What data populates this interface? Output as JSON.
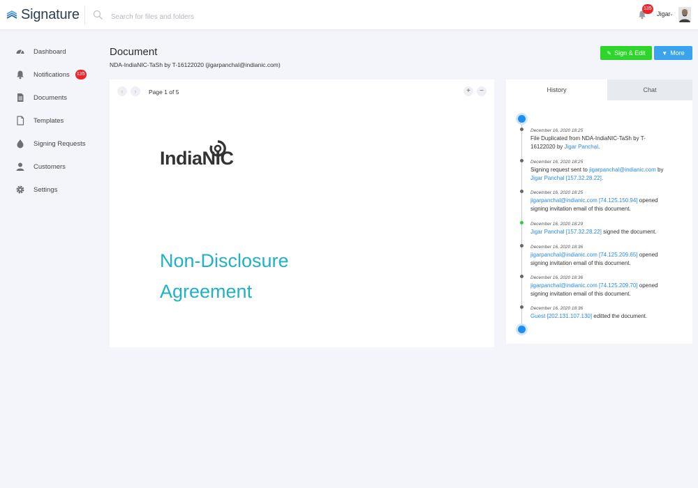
{
  "app": {
    "name": "Signature"
  },
  "search": {
    "placeholder": "Search for files and folders"
  },
  "topbar": {
    "notification_count": "135",
    "user_name": "Jigar",
    "chevron": "⌄"
  },
  "sidebar": {
    "items": [
      {
        "label": "Dashboard",
        "icon": "dashboard-icon"
      },
      {
        "label": "Notifications",
        "icon": "bell-icon",
        "badge": "135"
      },
      {
        "label": "Documents",
        "icon": "document-icon"
      },
      {
        "label": "Templates",
        "icon": "template-icon"
      },
      {
        "label": "Signing Requests",
        "icon": "signing-request-icon"
      },
      {
        "label": "Customers",
        "icon": "customers-icon"
      },
      {
        "label": "Settings",
        "icon": "gear-icon"
      }
    ]
  },
  "header": {
    "title": "Document",
    "subtitle": "NDA-IndiaNIC-TaSh by T-16122020 (jigarpanchal@indianic.com)",
    "sign_edit_label": "Sign & Edit",
    "more_label": "More"
  },
  "viewer": {
    "prev": "‹",
    "next": "›",
    "page_text": "Page 1 of 5",
    "zoom_in": "+",
    "zoom_out": "−",
    "logo_text": "IndiaNIC",
    "doc_title_line1": "Non-Disclosure",
    "doc_title_line2": "Agreement"
  },
  "panel": {
    "tabs": {
      "history": "History",
      "chat": "Chat"
    },
    "history": [
      {
        "time": "December 16, 2020 18:25",
        "parts": [
          [
            "File Duplicated from NDA-IndiaNIC-TaSh by T-16122020 by ",
            ""
          ],
          [
            "Jigar Panchal",
            "link"
          ],
          [
            ".",
            ""
          ]
        ]
      },
      {
        "time": "December 16, 2020 18:25",
        "parts": [
          [
            "Signing request sent to ",
            ""
          ],
          [
            "jigarpanchal@indianic.com",
            "link"
          ],
          [
            " by ",
            ""
          ],
          [
            "Jigar Panchal [157.32.28.22]",
            "link"
          ],
          [
            ".",
            ""
          ]
        ]
      },
      {
        "time": "December 16, 2020 18:25",
        "parts": [
          [
            "jigarpanchal@indianic.com [74.125.150.94]",
            "link"
          ],
          [
            " opened signing invitation email of this document.",
            ""
          ]
        ]
      },
      {
        "time": "December 16, 2020 18:29",
        "parts": [
          [
            "Jigar Panchal [157.32.28.22]",
            "link"
          ],
          [
            " signed the document.",
            ""
          ]
        ]
      },
      {
        "time": "December 16, 2020 18:36",
        "parts": [
          [
            "jigarpanchal@indianic.com [74.125.209.65]",
            "link"
          ],
          [
            " opened signing invitation email of this document.",
            ""
          ]
        ]
      },
      {
        "time": "December 16, 2020 18:36",
        "parts": [
          [
            "jigarpanchal@indianic.com [74.125.209.70]",
            "link"
          ],
          [
            " opened signing invitation email of this document.",
            ""
          ]
        ]
      },
      {
        "time": "December 16, 2020 18:36",
        "parts": [
          [
            "Guest [202.131.107.130]",
            "link"
          ],
          [
            " editted the document.",
            ""
          ]
        ]
      }
    ]
  },
  "colors": {
    "accent_blue": "#3aa3ee",
    "sign_green": "#2ed62b",
    "badge_red": "#e8262b",
    "title_teal": "#1fb1c6",
    "link_blue": "#2a8ae8"
  }
}
